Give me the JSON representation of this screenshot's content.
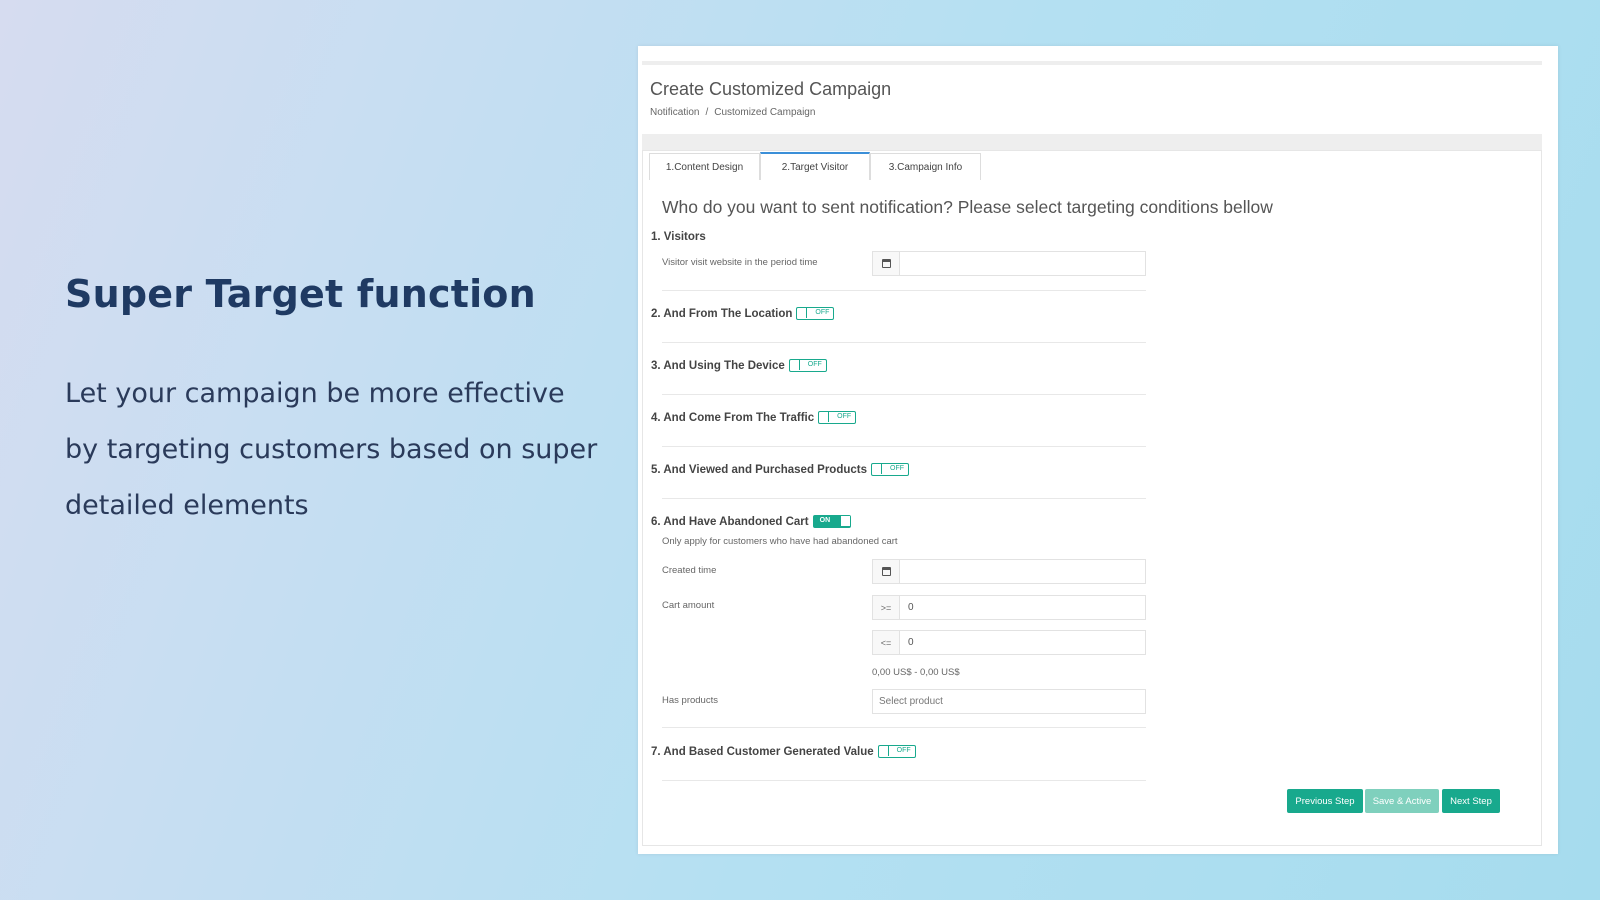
{
  "promo": {
    "title": "Super Target function",
    "text": "Let your campaign be more effective by targeting customers based on super detailed elements"
  },
  "page": {
    "title": "Create Customized Campaign",
    "breadcrumb": [
      "Notification",
      "/",
      "Customized Campaign"
    ]
  },
  "tabs": [
    {
      "label": "1.Content Design",
      "active": false
    },
    {
      "label": "2.Target Visitor",
      "active": true
    },
    {
      "label": "3.Campaign Info",
      "active": false
    }
  ],
  "question": "Who do you want to sent notification? Please select targeting conditions bellow",
  "sections": {
    "visitors": {
      "title": "1. Visitors",
      "field_label": "Visitor visit website in the period time",
      "value": ""
    },
    "location": {
      "title": "2. And From The Location",
      "toggle": "OFF"
    },
    "device": {
      "title": "3. And Using The Device",
      "toggle": "OFF"
    },
    "traffic": {
      "title": "4. And Come From The Traffic",
      "toggle": "OFF"
    },
    "products": {
      "title": "5. And Viewed and Purchased Products",
      "toggle": "OFF"
    },
    "cart": {
      "title": "6. And Have Abandoned Cart",
      "toggle": "ON",
      "hint": "Only apply for customers who have had abandoned cart",
      "created_time_label": "Created time",
      "created_time_value": "",
      "cart_amount_label": "Cart amount",
      "min_op": ">=",
      "min_value": "0",
      "max_op": "<=",
      "max_value": "0",
      "range_text": "0,00 US$ - 0,00 US$",
      "has_products_label": "Has products",
      "product_placeholder": "Select product"
    },
    "cgv": {
      "title": "7. And Based Customer Generated Value",
      "toggle": "OFF"
    }
  },
  "buttons": {
    "previous": "Previous Step",
    "save": "Save & Active",
    "next": "Next Step"
  },
  "colors": {
    "accent": "#18a98d",
    "accent_light": "#7fd0bd",
    "tab_active": "#3b8fd8",
    "heading": "#1f3a63"
  }
}
